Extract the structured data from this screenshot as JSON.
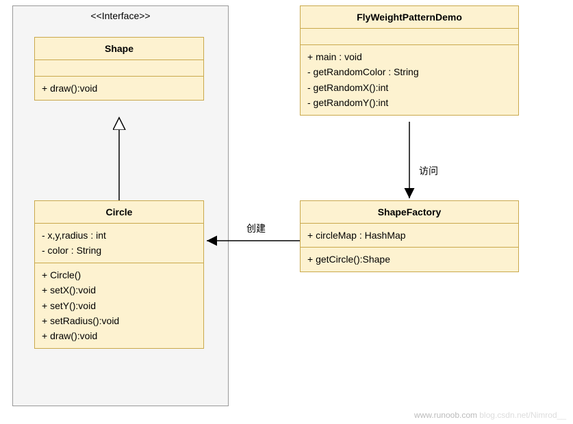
{
  "package": {
    "stereotype": "<<Interface>>"
  },
  "shape": {
    "name": "Shape",
    "methods": [
      "+ draw():void"
    ]
  },
  "circle": {
    "name": "Circle",
    "attrs": [
      "- x,y,radius : int",
      "- color : String"
    ],
    "methods": [
      "+ Circle()",
      "+ setX():void",
      "+ setY():void",
      "+ setRadius():void",
      "+ draw():void"
    ]
  },
  "demo": {
    "name": "FlyWeightPatternDemo",
    "methods": [
      "+ main : void",
      "- getRandomColor : String",
      "- getRandomX():int",
      "- getRandomY():int"
    ]
  },
  "factory": {
    "name": "ShapeFactory",
    "attrs": [
      "+ circleMap : HashMap"
    ],
    "methods": [
      "+ getCircle():Shape"
    ]
  },
  "labels": {
    "access": "访问",
    "create": "创建"
  },
  "watermarks": {
    "runoob": "www.runoob.com",
    "csdn": "blog.csdn.net/Nimrod__"
  }
}
